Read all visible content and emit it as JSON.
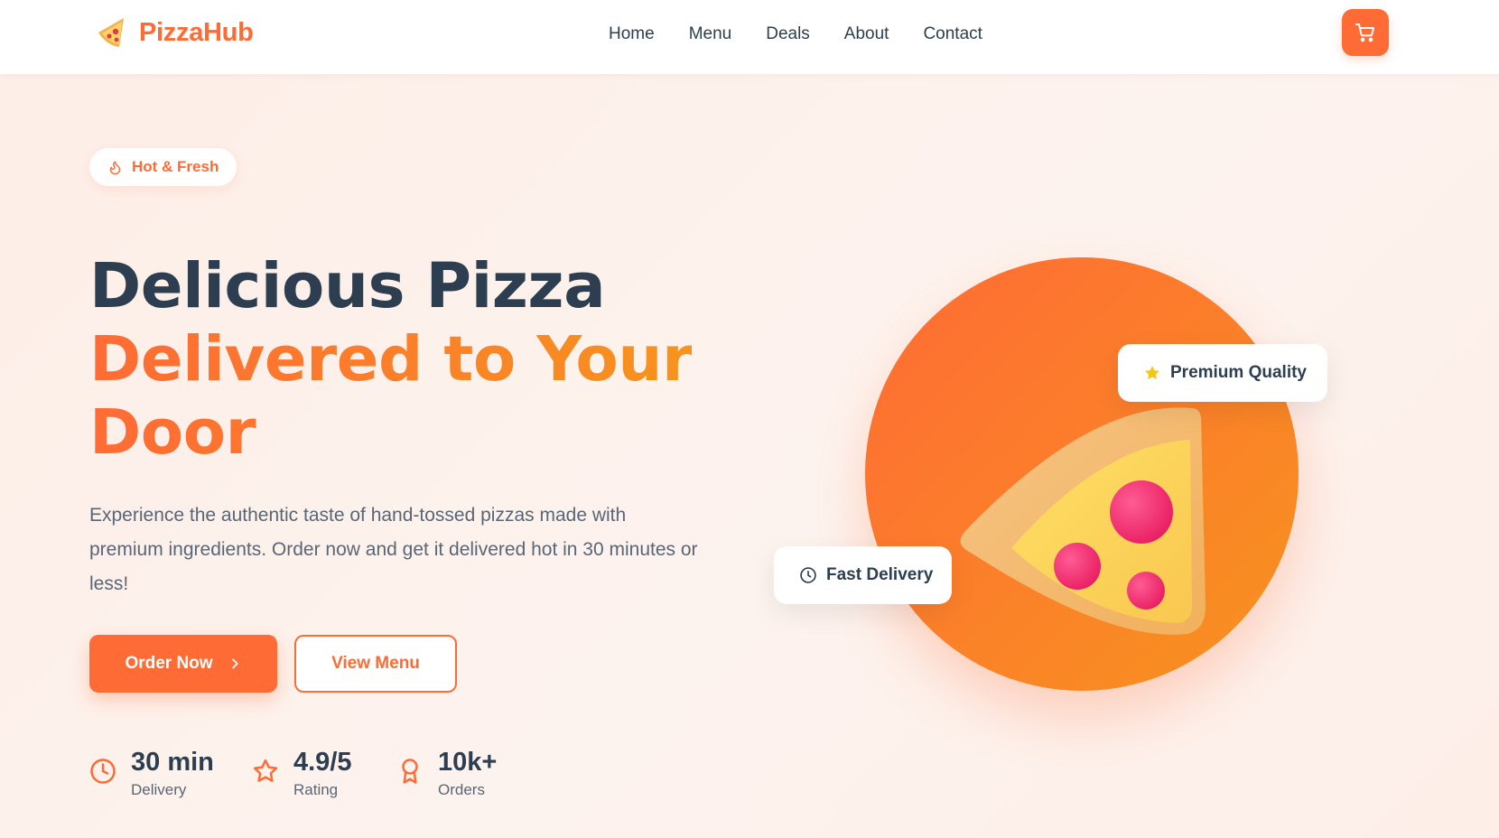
{
  "brand": {
    "name": "PizzaHub",
    "logo_icon": "pizza-slice-icon",
    "accent": "#ff6b35",
    "accent2": "#f7931e"
  },
  "nav": {
    "items": [
      "Home",
      "Menu",
      "Deals",
      "About",
      "Contact"
    ]
  },
  "header": {
    "cart_icon": "cart-icon"
  },
  "hero": {
    "badge": {
      "icon": "flame-icon",
      "label": "Hot & Fresh"
    },
    "title": {
      "line1": "Delicious Pizza",
      "line2": "Delivered to Your",
      "line3": "Door"
    },
    "description": "Experience the authentic taste of hand-tossed pizzas made with premium ingredients. Order now and get it delivered hot in 30 minutes or less!",
    "buttons": {
      "order": "Order Now",
      "order_icon": "chevron-right-icon",
      "menu": "View Menu"
    },
    "stats": [
      {
        "icon": "clock-icon",
        "value": "30 min",
        "label": "Delivery"
      },
      {
        "icon": "star-icon",
        "value": "4.9/5",
        "label": "Rating"
      },
      {
        "icon": "award-icon",
        "value": "10k+",
        "label": "Orders"
      }
    ]
  },
  "visual": {
    "cards": {
      "quality": {
        "icon": "star-icon",
        "label": "Premium Quality"
      },
      "delivery": {
        "icon": "clock-icon",
        "label": "Fast Delivery"
      }
    }
  }
}
